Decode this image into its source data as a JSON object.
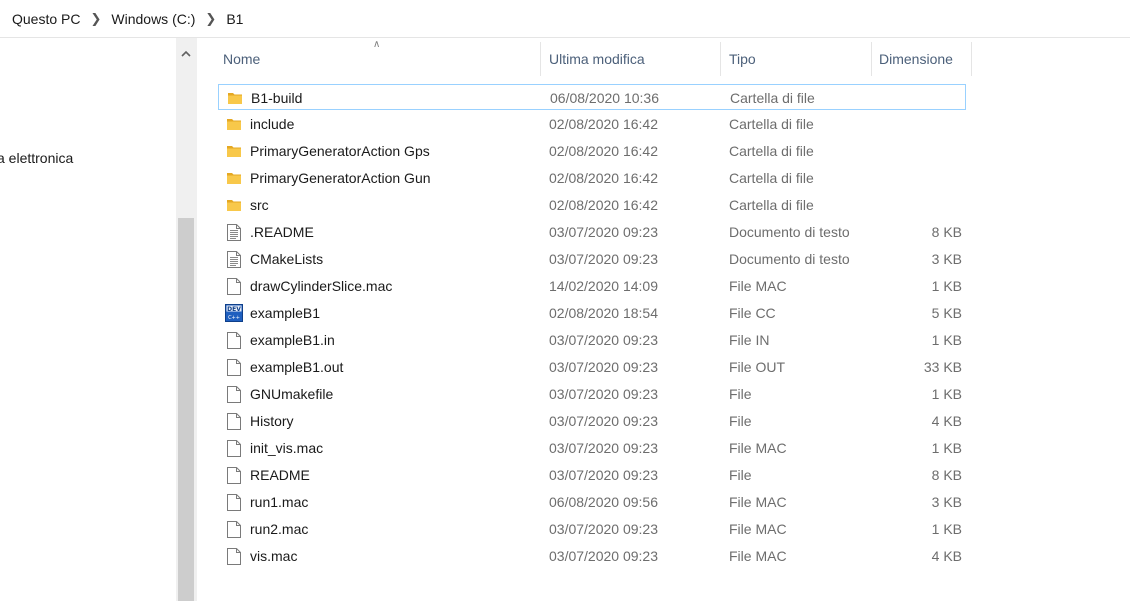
{
  "breadcrumb": [
    "Questo PC",
    "Windows (C:)",
    "B1"
  ],
  "nav": {
    "partial_item": "a elettronica"
  },
  "columns": {
    "name": "Nome",
    "modified": "Ultima modifica",
    "type": "Tipo",
    "size": "Dimensione"
  },
  "files": [
    {
      "name": "B1-build",
      "modified": "06/08/2020 10:36",
      "type": "Cartella di file",
      "size": "",
      "icon": "folder-icon"
    },
    {
      "name": "include",
      "modified": "02/08/2020 16:42",
      "type": "Cartella di file",
      "size": "",
      "icon": "folder-icon"
    },
    {
      "name": "PrimaryGeneratorAction Gps",
      "modified": "02/08/2020 16:42",
      "type": "Cartella di file",
      "size": "",
      "icon": "folder-icon"
    },
    {
      "name": "PrimaryGeneratorAction Gun",
      "modified": "02/08/2020 16:42",
      "type": "Cartella di file",
      "size": "",
      "icon": "folder-icon"
    },
    {
      "name": "src",
      "modified": "02/08/2020 16:42",
      "type": "Cartella di file",
      "size": "",
      "icon": "folder-icon"
    },
    {
      "name": ".README",
      "modified": "03/07/2020 09:23",
      "type": "Documento di testo",
      "size": "8 KB",
      "icon": "text-document-icon"
    },
    {
      "name": "CMakeLists",
      "modified": "03/07/2020 09:23",
      "type": "Documento di testo",
      "size": "3 KB",
      "icon": "text-document-icon"
    },
    {
      "name": "drawCylinderSlice.mac",
      "modified": "14/02/2020 14:09",
      "type": "File MAC",
      "size": "1 KB",
      "icon": "blank-file-icon"
    },
    {
      "name": "exampleB1",
      "modified": "02/08/2020 18:54",
      "type": "File CC",
      "size": "5 KB",
      "icon": "dev-cpp-file-icon"
    },
    {
      "name": "exampleB1.in",
      "modified": "03/07/2020 09:23",
      "type": "File IN",
      "size": "1 KB",
      "icon": "blank-file-icon"
    },
    {
      "name": "exampleB1.out",
      "modified": "03/07/2020 09:23",
      "type": "File OUT",
      "size": "33 KB",
      "icon": "blank-file-icon"
    },
    {
      "name": "GNUmakefile",
      "modified": "03/07/2020 09:23",
      "type": "File",
      "size": "1 KB",
      "icon": "blank-file-icon"
    },
    {
      "name": "History",
      "modified": "03/07/2020 09:23",
      "type": "File",
      "size": "4 KB",
      "icon": "blank-file-icon"
    },
    {
      "name": "init_vis.mac",
      "modified": "03/07/2020 09:23",
      "type": "File MAC",
      "size": "1 KB",
      "icon": "blank-file-icon"
    },
    {
      "name": "README",
      "modified": "03/07/2020 09:23",
      "type": "File",
      "size": "8 KB",
      "icon": "blank-file-icon"
    },
    {
      "name": "run1.mac",
      "modified": "06/08/2020 09:56",
      "type": "File MAC",
      "size": "3 KB",
      "icon": "blank-file-icon"
    },
    {
      "name": "run2.mac",
      "modified": "03/07/2020 09:23",
      "type": "File MAC",
      "size": "1 KB",
      "icon": "blank-file-icon"
    },
    {
      "name": "vis.mac",
      "modified": "03/07/2020 09:23",
      "type": "File MAC",
      "size": "4 KB",
      "icon": "blank-file-icon"
    }
  ],
  "selected_index": 0,
  "colors": {
    "header_text": "#4c607a",
    "selection_border": "#99d1ff",
    "folder": "#f8c84a",
    "detail_text": "#6d6d6d"
  }
}
